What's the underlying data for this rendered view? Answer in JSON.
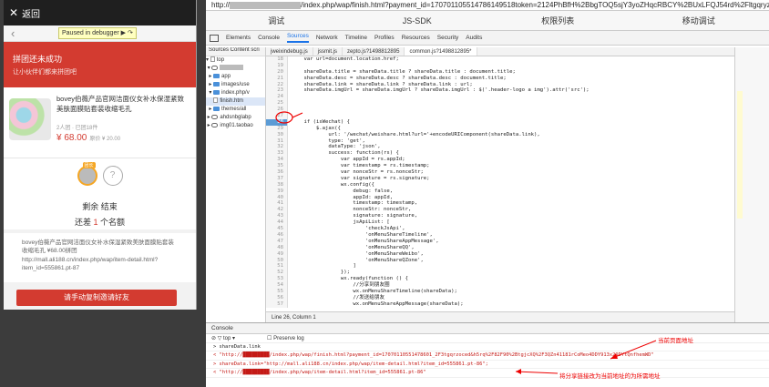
{
  "phone": {
    "close_label": "返回",
    "paused_badge": "Paused in debugger",
    "banner_title": "拼团还未成功",
    "banner_sub": "让小伙伴们都来拼团吧",
    "product_title": "bovey伯薇产品官网洁面仪女补水保湿紧致美肤面膜贴套装收缩毛孔",
    "product_meta": "2人团 · 已团18件",
    "price": "¥ 68.00",
    "orig_price": "原价 ¥ 20.00",
    "leader_tag": "团长",
    "question_mark": "?",
    "remain_line": "剩余 结束",
    "need_prefix": "还差",
    "need_count": "1",
    "need_suffix": "个名额",
    "share_text": "bovey伯薇产品官网洁面仪女补水保湿紧致美肤面膜贴套装收缩毛孔 ¥68.00拼团 http://mall.ali188.cn/index.php/wap/item-detail.html?item_id=555861.pt-87",
    "invite_button": "请手动复制邀请好友"
  },
  "devtools": {
    "url_prefix": "http://",
    "url_suffix": "/index.php/wap/finish.html?payment_id=170701105514786149518token=2124PhBfH%2BbgTOQ5sjY3yoZHqcRBCY%2BUxLFQJ54rd%2Fltgqryzoced&",
    "wx_tabs": [
      "调试",
      "JS-SDK",
      "权限列表",
      "移动调试"
    ],
    "dt_tabs": [
      "Elements",
      "Console",
      "Sources",
      "Network",
      "Timeline",
      "Profiles",
      "Resources",
      "Security",
      "Audits"
    ],
    "nav_tabs": "Sources Content scri",
    "tree": [
      "top",
      "app",
      "images/use",
      "index.php/v",
      "finish.htm",
      "themes/all",
      "ahdsnbglabp",
      "img01.taobao"
    ],
    "file_tabs": [
      "jweixindebug.js",
      "jssmit.js",
      "zepto.js?1498812895",
      "common.js?1498812895*"
    ],
    "status": "Line 26, Column 1"
  },
  "code": [
    {
      "n": "18",
      "t": "    var url=document.location.href;"
    },
    {
      "n": "19",
      "t": ""
    },
    {
      "n": "20",
      "t": "    shareData.title = shareData.title ? shareData.title : document.title;"
    },
    {
      "n": "21",
      "t": "    shareData.desc = shareData.desc ? shareData.desc : document.title;"
    },
    {
      "n": "22",
      "t": "    shareData.link = shareData.link ? shareData.link : url;"
    },
    {
      "n": "23",
      "t": "    shareData.imgUrl = shareData.imgUrl ? shareData.imgUrl : $('.header-logo a img').attr('src');"
    },
    {
      "n": "24",
      "t": ""
    },
    {
      "n": "25",
      "t": ""
    },
    {
      "n": "26",
      "t": ""
    },
    {
      "n": "27",
      "t": ""
    },
    {
      "n": "28",
      "t": "    if (isWechat) {"
    },
    {
      "n": "29",
      "t": "        $.ajax({"
    },
    {
      "n": "30",
      "t": "            url: '/wechat/weishare.html?url='+encodeURIComponent(shareData.link),"
    },
    {
      "n": "31",
      "t": "            type: 'get',"
    },
    {
      "n": "32",
      "t": "            dataType: 'json',"
    },
    {
      "n": "33",
      "t": "            success: function(rs) {"
    },
    {
      "n": "34",
      "t": "                var appId = rs.appId;"
    },
    {
      "n": "35",
      "t": "                var timestamp = rs.timestamp;"
    },
    {
      "n": "36",
      "t": "                var nonceStr = rs.nonceStr;"
    },
    {
      "n": "37",
      "t": "                var signature = rs.signature;"
    },
    {
      "n": "38",
      "t": "                wx.config({"
    },
    {
      "n": "39",
      "t": "                    debug: false,"
    },
    {
      "n": "40",
      "t": "                    appId: appId,"
    },
    {
      "n": "41",
      "t": "                    timestamp: timestamp,"
    },
    {
      "n": "42",
      "t": "                    nonceStr: nonceStr,"
    },
    {
      "n": "43",
      "t": "                    signature: signature,"
    },
    {
      "n": "44",
      "t": "                    jsApiList: ["
    },
    {
      "n": "45",
      "t": "                        'checkJsApi',"
    },
    {
      "n": "46",
      "t": "                        'onMenuShareTimeline',"
    },
    {
      "n": "47",
      "t": "                        'onMenuShareAppMessage',"
    },
    {
      "n": "48",
      "t": "                        'onMenuShareQQ',"
    },
    {
      "n": "49",
      "t": "                        'onMenuShareWeibo',"
    },
    {
      "n": "50",
      "t": "                        'onMenuShareQZone',"
    },
    {
      "n": "51",
      "t": "                    ]"
    },
    {
      "n": "52",
      "t": "                });"
    },
    {
      "n": "53",
      "t": "                wx.ready(function () {"
    },
    {
      "n": "54",
      "t": "                    //分享到朋友圈"
    },
    {
      "n": "55",
      "t": "                    wx.onMenuShareTimeline(shareData);"
    },
    {
      "n": "56",
      "t": "                    //发送给朋友"
    },
    {
      "n": "57",
      "t": "                    wx.onMenuShareAppMessage(shareData);"
    }
  ],
  "console": {
    "tab": "Console",
    "filter_top": "top",
    "preserve_log": "Preserve log",
    "lines": [
      "> shareData.link",
      "< \"http://█████████/index.php/wap/finish.html?payment_id=17070110551478601_2F3tgqrzoced&h5rq%2F82F90%2BtgjcXQ%2F3QZn41181rCoMeo4DDY913x29DYtQnfhemWD\"",
      "> shareData.link=\"http://mall.ali188.cn/index.php/wap/item-detail.html?item_id=555861.pt-86\";",
      "< \"http://█████████/index.php/wap/item-detail.html?item_id=555861.pt-86\""
    ],
    "anno1": "当前页面地址",
    "anno2": "将分享链接改为当前地址的为所需地址"
  }
}
